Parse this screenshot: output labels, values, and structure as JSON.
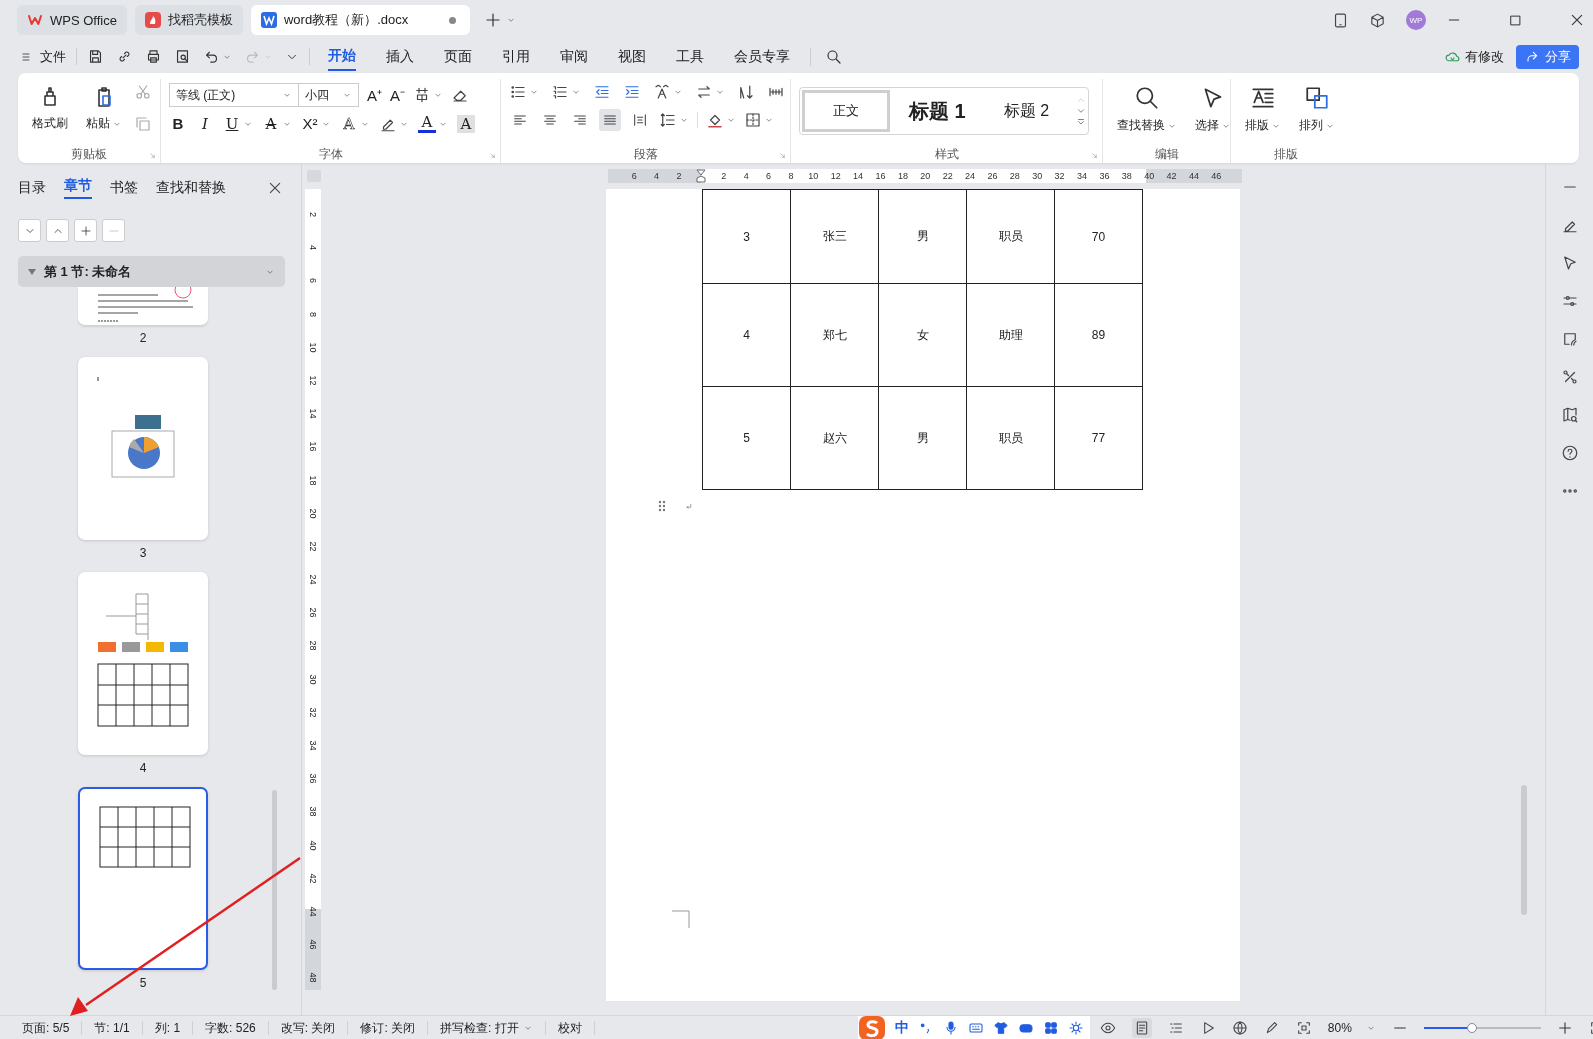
{
  "title_bar": {
    "tabs": [
      {
        "kind": "app",
        "label": "WPS Office",
        "selected": false,
        "modified": false
      },
      {
        "kind": "template",
        "label": "找稻壳模板",
        "selected": false,
        "modified": false
      },
      {
        "kind": "document",
        "label": "word教程（新）.docx",
        "selected": true,
        "modified": true
      }
    ],
    "avatar": "WP"
  },
  "menu_bar": {
    "file": "文件",
    "tabs": [
      {
        "label": "开始",
        "selected": true
      },
      {
        "label": "插入",
        "selected": false
      },
      {
        "label": "页面",
        "selected": false
      },
      {
        "label": "引用",
        "selected": false
      },
      {
        "label": "审阅",
        "selected": false
      },
      {
        "label": "视图",
        "selected": false
      },
      {
        "label": "工具",
        "selected": false
      },
      {
        "label": "会员专享",
        "selected": false
      }
    ],
    "status": "有修改",
    "share": "分享"
  },
  "ribbon": {
    "clipboard": {
      "title": "剪贴板",
      "buttons": [
        "格式刷",
        "粘贴"
      ]
    },
    "font": {
      "title": "字体",
      "font_name": "等线 (正文)",
      "font_size": "小四",
      "size_buttons": [
        "A⁺",
        "A⁻"
      ],
      "format_buttons": [
        {
          "kind": "bold",
          "label": "B"
        },
        {
          "kind": "italic",
          "label": "I"
        },
        {
          "kind": "underline",
          "label": "U"
        },
        {
          "kind": "strike",
          "label": "A"
        },
        {
          "kind": "superscript",
          "label": "X²"
        },
        {
          "kind": "effect",
          "label": "A"
        },
        {
          "kind": "highlight"
        },
        {
          "kind": "color",
          "label": "A"
        },
        {
          "kind": "shading",
          "label": "A"
        }
      ]
    },
    "paragraph": {
      "title": "段落",
      "alignments": [
        {
          "kind": "left",
          "selected": false
        },
        {
          "kind": "center",
          "selected": false
        },
        {
          "kind": "right",
          "selected": false
        },
        {
          "kind": "justify",
          "selected": true
        },
        {
          "kind": "distribute",
          "selected": false
        }
      ]
    },
    "styles": {
      "title": "样式",
      "items": [
        {
          "kind": "body",
          "label": "正文",
          "selected": true
        },
        {
          "kind": "heading1",
          "label": "标题 1",
          "selected": false
        },
        {
          "kind": "heading2",
          "label": "标题 2",
          "selected": false
        }
      ]
    },
    "editing": {
      "title": "编辑",
      "buttons": [
        "查找替换",
        "选择"
      ]
    },
    "layout": {
      "title": "排版",
      "buttons": [
        "排版",
        "排列"
      ]
    }
  },
  "side_panel": {
    "tabs": [
      {
        "label": "目录",
        "selected": false
      },
      {
        "label": "章节",
        "selected": true
      },
      {
        "label": "书签",
        "selected": false
      },
      {
        "label": "查找和替换",
        "selected": false
      }
    ],
    "section": "第 1 节: 未命名",
    "thumbnails": [
      {
        "kind": "text",
        "page": "2",
        "selected": false
      },
      {
        "kind": "chart",
        "page": "3",
        "selected": false
      },
      {
        "kind": "diagram",
        "page": "4",
        "selected": false
      },
      {
        "kind": "table",
        "page": "5",
        "selected": true
      }
    ]
  },
  "rulers": {
    "horizontal": [
      "6",
      "4",
      "2",
      "2",
      "4",
      "6",
      "8",
      "10",
      "12",
      "14",
      "16",
      "18",
      "20",
      "22",
      "24",
      "26",
      "28",
      "30",
      "32",
      "34",
      "36",
      "38",
      "40",
      "42",
      "44",
      "46"
    ],
    "vertical": [
      "2",
      "4",
      "6",
      "8",
      "10",
      "12",
      "14",
      "16",
      "18",
      "20",
      "22",
      "24",
      "26",
      "28",
      "30",
      "32",
      "34",
      "36",
      "38",
      "40",
      "42",
      "44",
      "46",
      "48"
    ]
  },
  "document": {
    "table": {
      "rows": [
        [
          "3",
          "张三",
          "男",
          "职员",
          "70"
        ],
        [
          "4",
          "郑七",
          "女",
          "助理",
          "89"
        ],
        [
          "5",
          "赵六",
          "男",
          "职员",
          "77"
        ]
      ]
    }
  },
  "status_bar": {
    "items": [
      "页面: 5/5",
      "节: 1/1",
      "列: 1",
      "字数: 526",
      "改写: 关闭",
      "修订: 关闭",
      "拼写检查: 打开",
      "校对"
    ],
    "ime": "中",
    "zoom": "80%",
    "zoom_level": {
      "level": 0.37
    }
  }
}
